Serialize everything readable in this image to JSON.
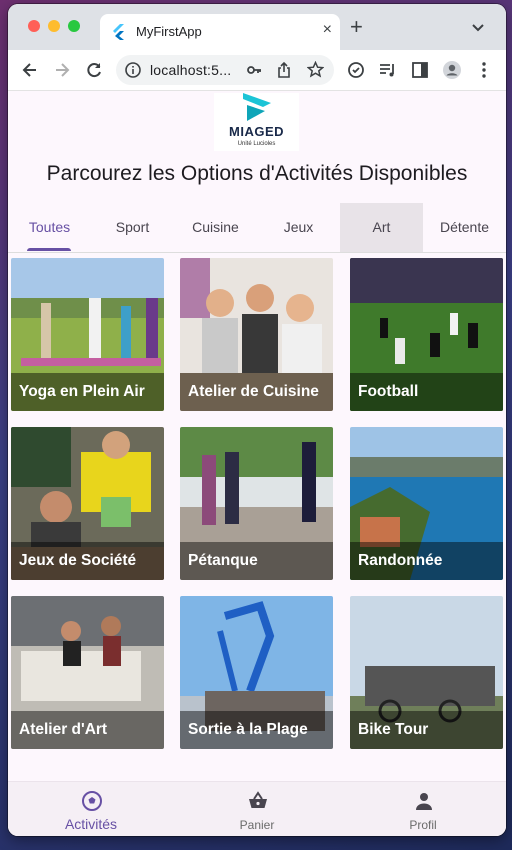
{
  "browser": {
    "tab_title": "MyFirstApp",
    "url": "localhost:5...",
    "new_tab": "+",
    "close": "×"
  },
  "app": {
    "logo": {
      "title": "MIAGED",
      "subtitle": "Unité Lucioles"
    },
    "heading": "Parcourez les Options d'Activités Disponibles",
    "tabs": [
      {
        "label": "Toutes",
        "active": true
      },
      {
        "label": "Sport"
      },
      {
        "label": "Cuisine"
      },
      {
        "label": "Jeux"
      },
      {
        "label": "Art",
        "hovered": true
      },
      {
        "label": "Détente"
      }
    ],
    "activities": [
      {
        "label": "Yoga en Plein Air"
      },
      {
        "label": "Atelier de Cuisine"
      },
      {
        "label": "Football"
      },
      {
        "label": "Jeux de Société"
      },
      {
        "label": "Pétanque"
      },
      {
        "label": "Randonnée"
      },
      {
        "label": "Atelier d'Art"
      },
      {
        "label": "Sortie à la Plage"
      },
      {
        "label": "Bike Tour"
      }
    ],
    "bottom_nav": [
      {
        "label": "Activités",
        "icon": "soccer-ball-icon",
        "active": true
      },
      {
        "label": "Panier",
        "icon": "basket-icon"
      },
      {
        "label": "Profil",
        "icon": "person-icon"
      }
    ]
  },
  "colors": {
    "accent": "#6750a4",
    "app_background": "#fdf7fd"
  }
}
